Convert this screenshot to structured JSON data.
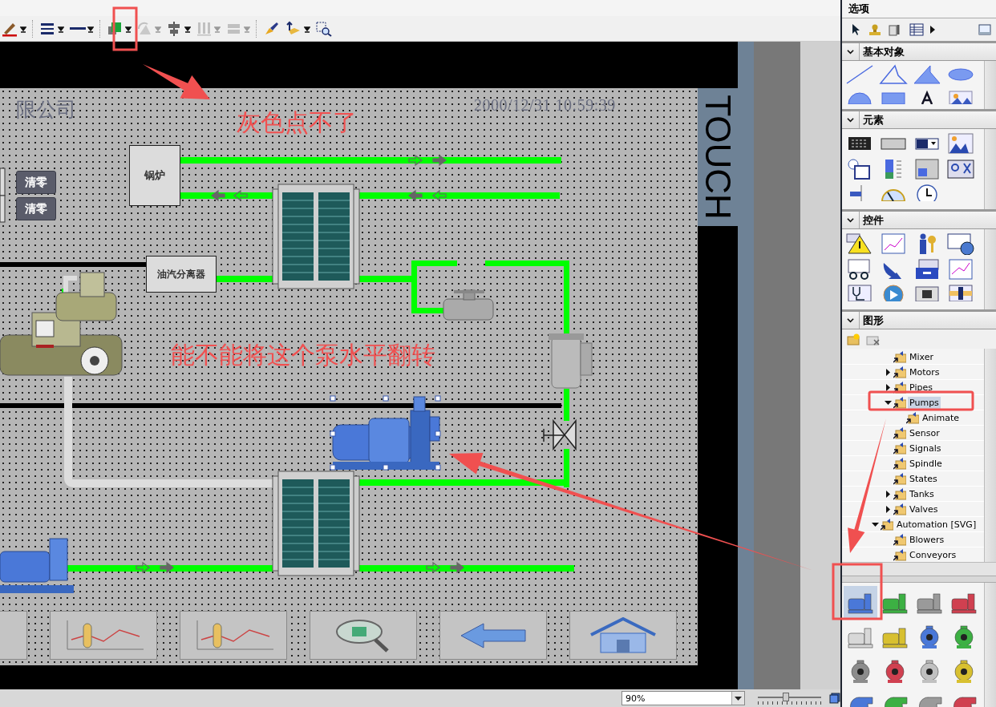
{
  "toolbar": [
    {
      "kind": "pen",
      "disabled": false
    },
    {
      "kind": "line-style",
      "disabled": false
    },
    {
      "kind": "line-width",
      "disabled": false
    },
    {
      "kind": "fill-color",
      "disabled": false
    },
    {
      "kind": "rotate",
      "disabled": true
    },
    {
      "kind": "align",
      "disabled": false
    },
    {
      "kind": "distribute",
      "disabled": true
    },
    {
      "kind": "same-size",
      "disabled": true
    },
    {
      "kind": "brush",
      "disabled": false
    },
    {
      "kind": "layer",
      "disabled": false
    },
    {
      "kind": "zoom-select",
      "disabled": false
    }
  ],
  "screen": {
    "company_name": "限公司",
    "datetime": "2000/12/31 10:59:39",
    "side_label": "TOUCH",
    "reset_buttons": [
      "清零",
      "清零"
    ],
    "boiler_label": "锅炉",
    "separator_label": "油汽分离器",
    "nav_buttons": [
      {
        "kind": "partial"
      },
      {
        "kind": "trend"
      },
      {
        "kind": "trend"
      },
      {
        "kind": "search"
      },
      {
        "kind": "back"
      },
      {
        "kind": "home"
      }
    ]
  },
  "annotations": [
    "灰色点不了",
    "能不能将这个泵水平翻转"
  ],
  "options_panel": {
    "title": "选项",
    "sections": [
      {
        "title": "基本对象",
        "kind": "basic-objects",
        "expanded": true
      },
      {
        "title": "元素",
        "kind": "elements",
        "expanded": true
      },
      {
        "title": "控件",
        "kind": "controls",
        "expanded": true
      },
      {
        "title": "图形",
        "kind": "graphics",
        "expanded": true
      }
    ],
    "tree": [
      {
        "children": [
          {
            "label": "Mixer",
            "selected": false
          },
          {
            "label": "Motors",
            "expanded": false,
            "selected": false
          },
          {
            "label": "Pipes",
            "expanded": false,
            "selected": false
          },
          {
            "label": "Pumps",
            "expanded": true,
            "selected": true,
            "children": [
              {
                "label": "Animate",
                "selected": false
              }
            ]
          },
          {
            "label": "Sensor",
            "selected": false
          },
          {
            "label": "Signals",
            "selected": false
          },
          {
            "label": "Spindle",
            "selected": false
          },
          {
            "label": "States",
            "selected": false
          },
          {
            "label": "Tanks",
            "expanded": false,
            "selected": false
          },
          {
            "label": "Valves",
            "expanded": false,
            "selected": false
          }
        ]
      },
      {
        "label": "Automation [SVG]",
        "expanded": true,
        "selected": false,
        "children": [
          {
            "label": "Blowers",
            "selected": false
          },
          {
            "label": "Conveyors",
            "selected": false
          }
        ]
      }
    ],
    "gallery": [
      {
        "kind": "motor-pump",
        "color": "#4a78d8",
        "selected": true
      },
      {
        "kind": "motor-pump",
        "color": "#3cb043",
        "selected": false
      },
      {
        "kind": "motor-pump",
        "color": "#9a9a9a",
        "selected": false
      },
      {
        "kind": "motor-pump",
        "color": "#d04050",
        "selected": false
      },
      {
        "kind": "motor-pump",
        "color": "#d8d8d8",
        "selected": false
      },
      {
        "kind": "motor-pump",
        "color": "#d8c030",
        "selected": false
      },
      {
        "kind": "centrifugal",
        "color": "#4a78d8",
        "selected": false
      },
      {
        "kind": "centrifugal",
        "color": "#3cb043",
        "selected": false
      },
      {
        "kind": "centrifugal",
        "color": "#8c8c8c",
        "selected": false
      },
      {
        "kind": "centrifugal",
        "color": "#d04050",
        "selected": false
      },
      {
        "kind": "centrifugal",
        "color": "#c0c0c0",
        "selected": false
      },
      {
        "kind": "centrifugal",
        "color": "#d8c030",
        "selected": false
      },
      {
        "kind": "volute",
        "color": "#4a78d8",
        "selected": false
      },
      {
        "kind": "volute",
        "color": "#3cb043",
        "selected": false
      },
      {
        "kind": "volute",
        "color": "#9a9a9a",
        "selected": false
      },
      {
        "kind": "volute",
        "color": "#d04050",
        "selected": false
      }
    ]
  },
  "status_bar": {
    "zoom": "90%",
    "zoom_slider": {
      "level": 0.45
    }
  }
}
